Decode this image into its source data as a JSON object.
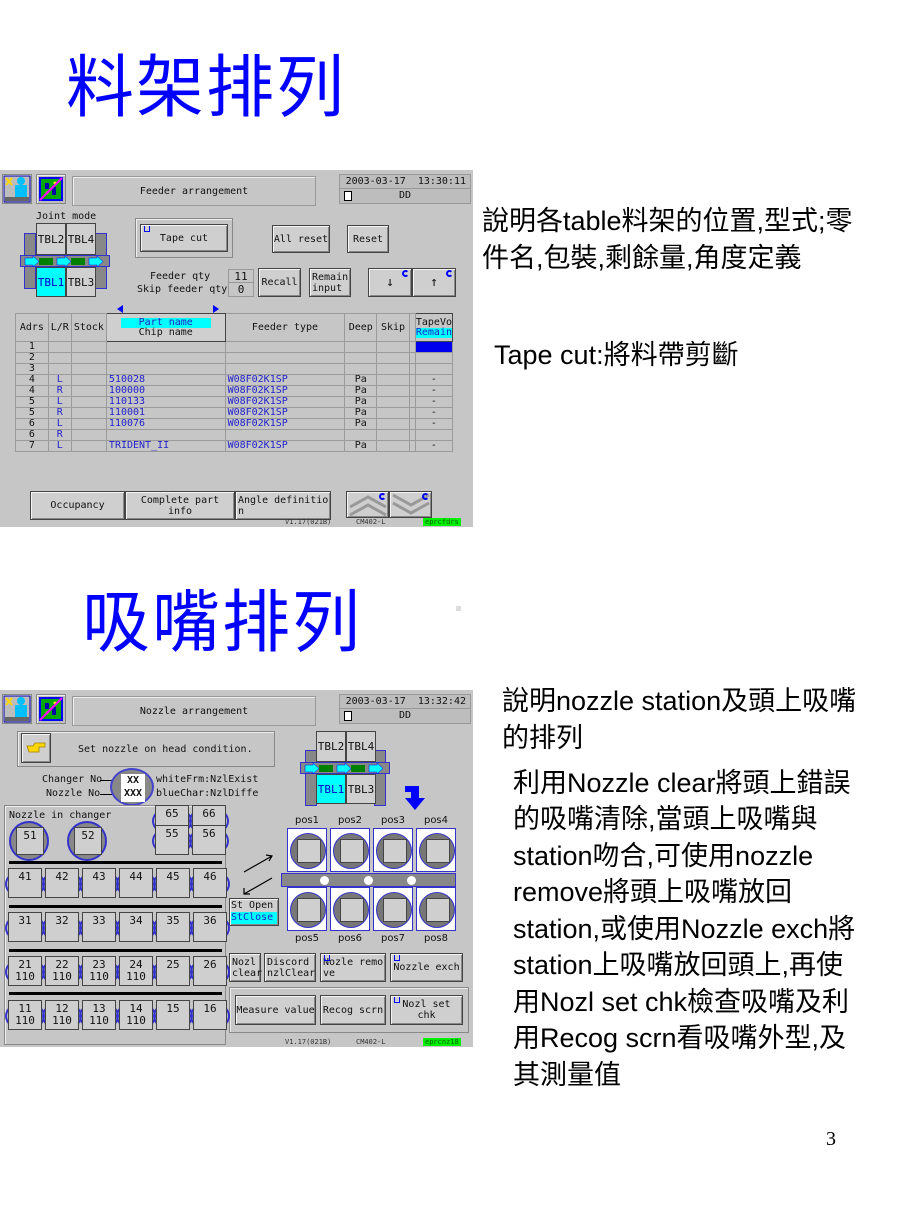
{
  "slide": {
    "title1": "料架排列",
    "title2": "吸嘴排列",
    "page_number": "3",
    "notes_feeder": [
      "說明各table料架的位置,型式;零",
      "件名,包裝,剩餘量,角度定義",
      "Tape cut:將料帶剪斷"
    ],
    "notes_nozzle": [
      "說明nozzle station及頭上吸嘴",
      "的排列",
      "利用Nozzle clear將頭上錯誤",
      "的吸嘴清除,當頭上吸嘴與",
      "station吻合,可使用nozzle",
      "remove將頭上吸嘴放回",
      "station,或使用Nozzle exch將",
      "station上吸嘴放回頭上,再使",
      "用Nozl set chk檢查吸嘴及利",
      "用Recog scrn看吸嘴外型,及",
      "其測量值"
    ]
  },
  "feeder_screen": {
    "icons": [
      "maintenance-person-icon",
      "board-icon"
    ],
    "title": "Feeder arrangement",
    "date": "2003-03-17",
    "time": "13:30:11",
    "doc_label": "DD",
    "joint_mode_label": "Joint mode",
    "tables": {
      "tbl2": "TBL2",
      "tbl4": "TBL4",
      "tbl1": "TBL1",
      "tbl3": "TBL3",
      "selected": "TBL1"
    },
    "buttons": {
      "tape_cut": "Tape cut",
      "all_reset": "All reset",
      "reset": "Reset",
      "recall": "Recall",
      "remain_input": "Remain input",
      "down": "↓",
      "up": "↑",
      "occupancy": "Occupancy",
      "complete_part_info": "Complete part info",
      "angle_definition": "Angle definitio n"
    },
    "feeder_qty_label": "Feeder qty",
    "feeder_qty": "11",
    "skip_feeder_qty_label": "Skip feeder qty",
    "skip_feeder_qty": "0",
    "columns": {
      "adrs": "Adrs",
      "lr": "L/R",
      "stock": "Stock",
      "part_name": "Part name",
      "chip_name": "Chip name",
      "feeder_type": "Feeder type",
      "deep": "Deep",
      "skip": "Skip",
      "tapevo": "TapeVo",
      "remain": "Remain"
    },
    "rows": [
      {
        "adrs": "1",
        "lr": "",
        "stock": "",
        "part": "",
        "type": "",
        "deep": "",
        "skip": "",
        "remain": ""
      },
      {
        "adrs": "2",
        "lr": "",
        "stock": "",
        "part": "",
        "type": "",
        "deep": "",
        "skip": "",
        "remain": ""
      },
      {
        "adrs": "3",
        "lr": "",
        "stock": "",
        "part": "",
        "type": "",
        "deep": "",
        "skip": "",
        "remain": ""
      },
      {
        "adrs": "4",
        "lr": "L",
        "stock": "",
        "part": "510028",
        "type": "W08F02K1SP",
        "deep": "Pa",
        "skip": "",
        "remain": "-"
      },
      {
        "adrs": "4",
        "lr": "R",
        "stock": "",
        "part": "100000",
        "type": "W08F02K1SP",
        "deep": "Pa",
        "skip": "",
        "remain": "-"
      },
      {
        "adrs": "5",
        "lr": "L",
        "stock": "",
        "part": "110133",
        "type": "W08F02K1SP",
        "deep": "Pa",
        "skip": "",
        "remain": "-"
      },
      {
        "adrs": "5",
        "lr": "R",
        "stock": "",
        "part": "110001",
        "type": "W08F02K1SP",
        "deep": "Pa",
        "skip": "",
        "remain": "-"
      },
      {
        "adrs": "6",
        "lr": "L",
        "stock": "",
        "part": "110076",
        "type": "W08F02K1SP",
        "deep": "Pa",
        "skip": "",
        "remain": "-"
      },
      {
        "adrs": "6",
        "lr": "R",
        "stock": "",
        "part": "",
        "type": "",
        "deep": "",
        "skip": "",
        "remain": ""
      },
      {
        "adrs": "7",
        "lr": "L",
        "stock": "",
        "part": "TRIDENT_II",
        "type": "W08F02K1SP",
        "deep": "Pa",
        "skip": "",
        "remain": "-"
      }
    ],
    "version": "V1.17(021B)",
    "machine": "CM402-L",
    "screen_id": "eprcfdrs"
  },
  "nozzle_screen": {
    "title": "Nozzle arrangement",
    "date": "2003-03-17",
    "time": "13:32:42",
    "doc_label": "DD",
    "message": "Set nozzle on head condition.",
    "changer_no_label": "Changer No",
    "nozzle_no_label": "Nozzle No",
    "legend_xx": "XX",
    "legend_xxx": "XXX",
    "legend_white": "whiteFrm:NzlExist",
    "legend_blue": "blueChar:NzlDiffe",
    "nozzle_in_changer_label": "Nozzle in changer",
    "tables": {
      "tbl2": "TBL2",
      "tbl4": "TBL4",
      "tbl1": "TBL1",
      "tbl3": "TBL3",
      "selected": "TBL1"
    },
    "changer_top": [
      {
        "no": "51",
        "nozzle": ""
      },
      {
        "no": "52",
        "nozzle": ""
      },
      {
        "no": "65",
        "nozzle": ""
      },
      {
        "no": "66",
        "nozzle": ""
      },
      {
        "no": "55",
        "nozzle": ""
      },
      {
        "no": "56",
        "nozzle": ""
      }
    ],
    "changer_rows": [
      [
        {
          "no": "41",
          "nozzle": ""
        },
        {
          "no": "42",
          "nozzle": ""
        },
        {
          "no": "43",
          "nozzle": ""
        },
        {
          "no": "44",
          "nozzle": ""
        },
        {
          "no": "45",
          "nozzle": ""
        },
        {
          "no": "46",
          "nozzle": ""
        }
      ],
      [
        {
          "no": "31",
          "nozzle": ""
        },
        {
          "no": "32",
          "nozzle": ""
        },
        {
          "no": "33",
          "nozzle": ""
        },
        {
          "no": "34",
          "nozzle": ""
        },
        {
          "no": "35",
          "nozzle": ""
        },
        {
          "no": "36",
          "nozzle": ""
        }
      ],
      [
        {
          "no": "21",
          "nozzle": "110"
        },
        {
          "no": "22",
          "nozzle": "110"
        },
        {
          "no": "23",
          "nozzle": "110"
        },
        {
          "no": "24",
          "nozzle": "110"
        },
        {
          "no": "25",
          "nozzle": ""
        },
        {
          "no": "26",
          "nozzle": ""
        }
      ],
      [
        {
          "no": "11",
          "nozzle": "110"
        },
        {
          "no": "12",
          "nozzle": "110"
        },
        {
          "no": "13",
          "nozzle": "110"
        },
        {
          "no": "14",
          "nozzle": "110"
        },
        {
          "no": "15",
          "nozzle": ""
        },
        {
          "no": "16",
          "nozzle": ""
        }
      ]
    ],
    "head_positions_top": [
      "pos1",
      "pos2",
      "pos3",
      "pos4"
    ],
    "head_positions_bottom": [
      "pos5",
      "pos6",
      "pos7",
      "pos8"
    ],
    "st_open": "St Open",
    "st_close": "StClose",
    "buttons": {
      "nozl_clear": "Nozl clear",
      "discord_nzl_clear": "Discord nzlClear",
      "nozle_remove": "Nozle remo ve",
      "nozzle_exch": "Nozzle exch",
      "measure_value": "Measure value",
      "recog_scrn": "Recog scrn",
      "nozl_set_chk": "Nozl set chk"
    },
    "version": "V1.17(021B)",
    "machine": "CM402-L",
    "screen_id": "eprcnz18"
  }
}
